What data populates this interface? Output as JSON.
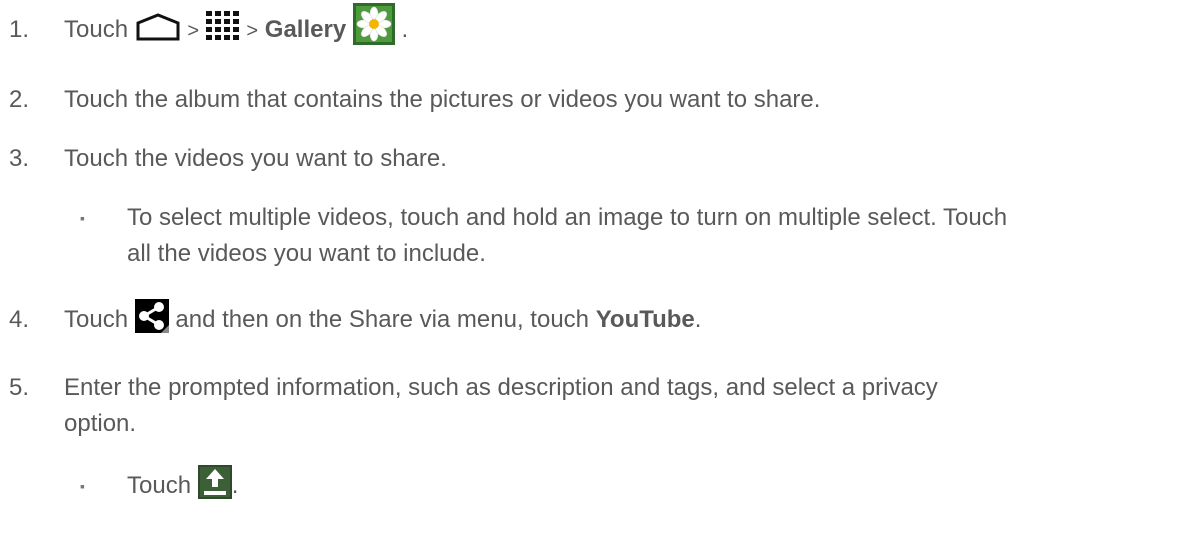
{
  "steps": {
    "s1": {
      "num": "1.",
      "touch": "Touch",
      "gt1": ">",
      "gt2": ">",
      "gallery": "Gallery",
      "end": "."
    },
    "s2": {
      "num": "2.",
      "text": "Touch the album that contains the pictures or videos you want to share."
    },
    "s3": {
      "num": "3.",
      "text": "Touch the videos you want to share."
    },
    "b1": {
      "bullet": "▪",
      "line1": "To select multiple videos, touch and hold an image to turn on multiple select. Touch",
      "line2": "all the videos you want to include."
    },
    "s4": {
      "num": "4.",
      "touch": "Touch",
      "mid": "and then on the Share via menu, touch",
      "youtube": "YouTube",
      "end": "."
    },
    "s5": {
      "num": "5.",
      "line1": "Enter the prompted information, such as description and tags, and select a privacy",
      "line2": "option."
    },
    "b2": {
      "bullet": "▪",
      "touch": "Touch",
      "end": "."
    }
  },
  "icons": {
    "home": "home-icon",
    "apps": "apps-grid-icon",
    "gallery": "gallery-flower-icon",
    "share": "share-icon",
    "upload": "upload-icon"
  }
}
